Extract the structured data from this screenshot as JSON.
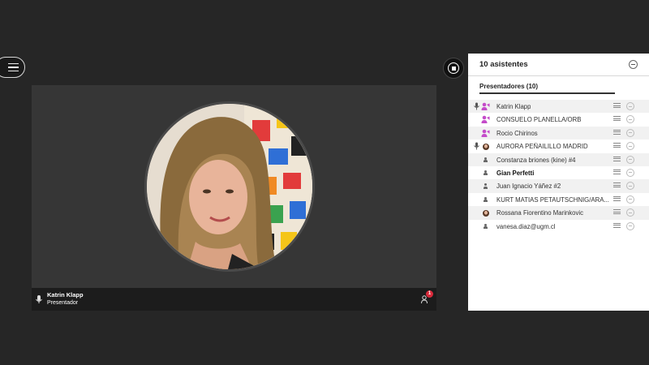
{
  "colors": {
    "background": "#262626",
    "stage": "#363636",
    "panel": "#ffffff",
    "presenter_icon": "#c44bc9",
    "notification_badge": "#d9293a"
  },
  "menu": {
    "icon": "hamburger-menu-icon"
  },
  "stage": {
    "presenter_name": "Katrin Klapp",
    "presenter_role": "Presentador",
    "raise_hand_count": "1"
  },
  "panel": {
    "title": "10 asistentes",
    "section_title": "Presentadores (10)",
    "attendees": [
      {
        "name": "Katrin Klapp",
        "role_icon": "presenter-icon",
        "mic": true,
        "bold": false
      },
      {
        "name": "CONSUELO PLANELLA/ORB",
        "role_icon": "presenter-icon",
        "mic": false,
        "bold": false
      },
      {
        "name": "Rocio Chirinos",
        "role_icon": "presenter-icon",
        "mic": false,
        "bold": false
      },
      {
        "name": "AURORA PEÑAILILLO MADRID",
        "role_icon": "avatar-photo",
        "mic": true,
        "bold": false
      },
      {
        "name": "Constanza briones (kine) #4",
        "role_icon": "participant-icon",
        "mic": false,
        "bold": false
      },
      {
        "name": "Gian Perfetti",
        "role_icon": "participant-icon",
        "mic": false,
        "bold": true
      },
      {
        "name": "Juan Ignacio Yáñez #2",
        "role_icon": "participant-icon",
        "mic": false,
        "bold": false
      },
      {
        "name": "KURT MATIAS PETAUTSCHNIG/ARA...",
        "role_icon": "participant-icon",
        "mic": false,
        "bold": false
      },
      {
        "name": "Rossana Fiorentino Marinkovic",
        "role_icon": "avatar-photo",
        "mic": false,
        "bold": false
      },
      {
        "name": "vanesa.diaz@ugm.cl",
        "role_icon": "participant-icon",
        "mic": false,
        "bold": false
      }
    ]
  }
}
